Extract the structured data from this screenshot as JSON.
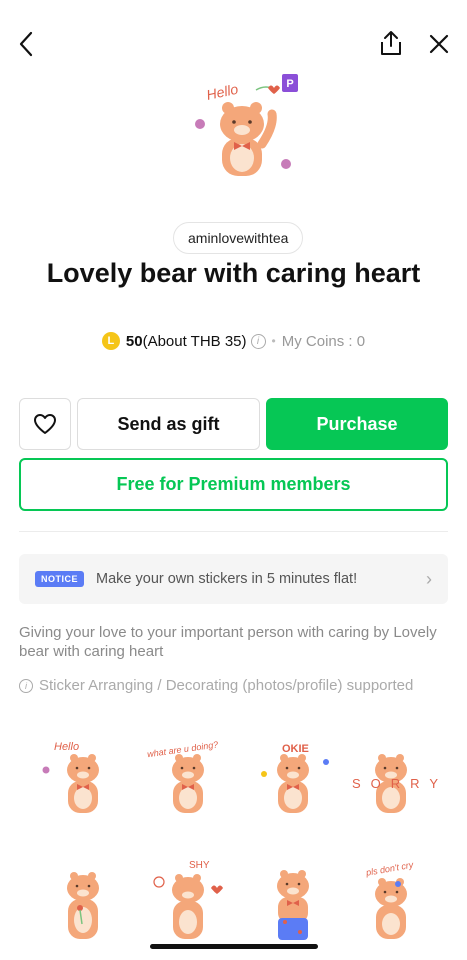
{
  "header": {
    "back_icon": "chevron-left-icon",
    "share_icon": "share-icon",
    "close_icon": "close-icon"
  },
  "product": {
    "hero_badge": "P",
    "hero_lettering": "Hello",
    "author": "aminlovewithtea",
    "title": "Lovely bear with caring heart",
    "coin_symbol": "L",
    "price_coins": "50",
    "price_local": "(About THB 35)",
    "my_coins": "My Coins : 0"
  },
  "actions": {
    "gift_label": "Send as gift",
    "purchase_label": "Purchase",
    "premium_label": "Free for Premium members"
  },
  "notice": {
    "badge": "NOTICE",
    "text": "Make your own stickers in 5 minutes flat!"
  },
  "description": "Giving your love to your important person with caring by Lovely bear with caring heart",
  "feature": "Sticker Arranging / Decorating (photos/profile) supported",
  "stickers": [
    {
      "caption": "Hello"
    },
    {
      "caption": "what are u doing?"
    },
    {
      "caption": "OKIE"
    },
    {
      "caption": "SORRY"
    },
    {
      "caption": ""
    },
    {
      "caption": "SHY"
    },
    {
      "caption": ""
    },
    {
      "caption": "pls don't cry"
    }
  ],
  "colors": {
    "accent_green": "#06c755",
    "bear": "#f4a77a",
    "notice_badge": "#5b7cf5",
    "coin": "#f5c518",
    "premium_badge": "#8b4fd8"
  }
}
